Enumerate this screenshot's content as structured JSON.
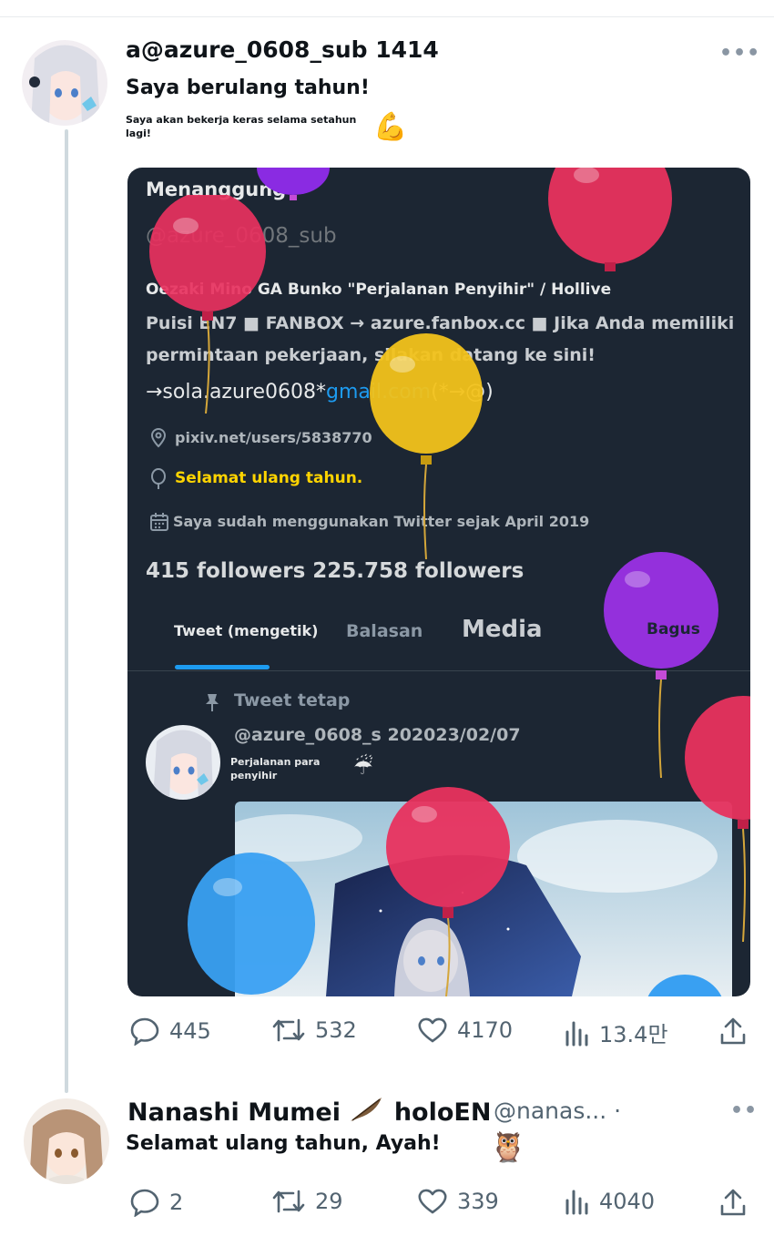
{
  "tweet1": {
    "display_name": "a@azure_0608_sub 1414",
    "text": "Saya berulang tahun!",
    "subtext": "Saya akan bekerja keras selama setahun lagi!",
    "emoji": "💪",
    "more_label": "•••",
    "embedded": {
      "header_name": "Menanggung",
      "handle": "@azure_0608_sub",
      "bio_line1": "Oezaki Mino GA Bunko \"Perjalanan Penyihir\" / Hollive",
      "bio_line2": "Puisi EN7 ■ FANBOX → azure.fanbox.cc ■ Jika Anda memiliki",
      "bio_line3": "permintaan pekerjaan, silakan datang ke sini!",
      "bio_line4_a": "→sola.azure0608*",
      "bio_line4_b": "gmail.com",
      "bio_line4_c": "(*→@)",
      "link": "pixiv.net/users/5838770",
      "birthday": "Selamat ulang tahun.",
      "joined": "Saya sudah menggunakan Twitter sejak April 2019",
      "follows": "415 followers 225.758 followers",
      "tabs": [
        "Tweet (mengetik)",
        "Balasan",
        "Media",
        "Bagus"
      ],
      "pinned_label": "Tweet tetap",
      "pinned_author": "@azure_0608_s 202023/02/07",
      "pinned_text": "Perjalanan para penyihir",
      "pinned_emoji": "☔",
      "colors": {
        "card_bg": "#1c2633",
        "accent": "#1d9bf0",
        "birthday": "#ffd400"
      }
    },
    "actions": {
      "replies": "445",
      "retweets": "532",
      "likes": "4170",
      "views": "13.4만"
    }
  },
  "tweet2": {
    "display_name": "Nanashi Mumei",
    "name_suffix": "holoEN",
    "handle": "@nanas... ·",
    "text": "Selamat ulang tahun, Ayah!",
    "emoji": "🦉",
    "more_label": "••",
    "actions": {
      "replies": "2",
      "retweets": "29",
      "likes": "339",
      "views": "4040"
    }
  },
  "icons": [
    "reply-icon",
    "retweet-icon",
    "like-icon",
    "views-icon",
    "share-icon",
    "location-icon",
    "balloon-icon",
    "calendar-icon",
    "pin-icon"
  ]
}
